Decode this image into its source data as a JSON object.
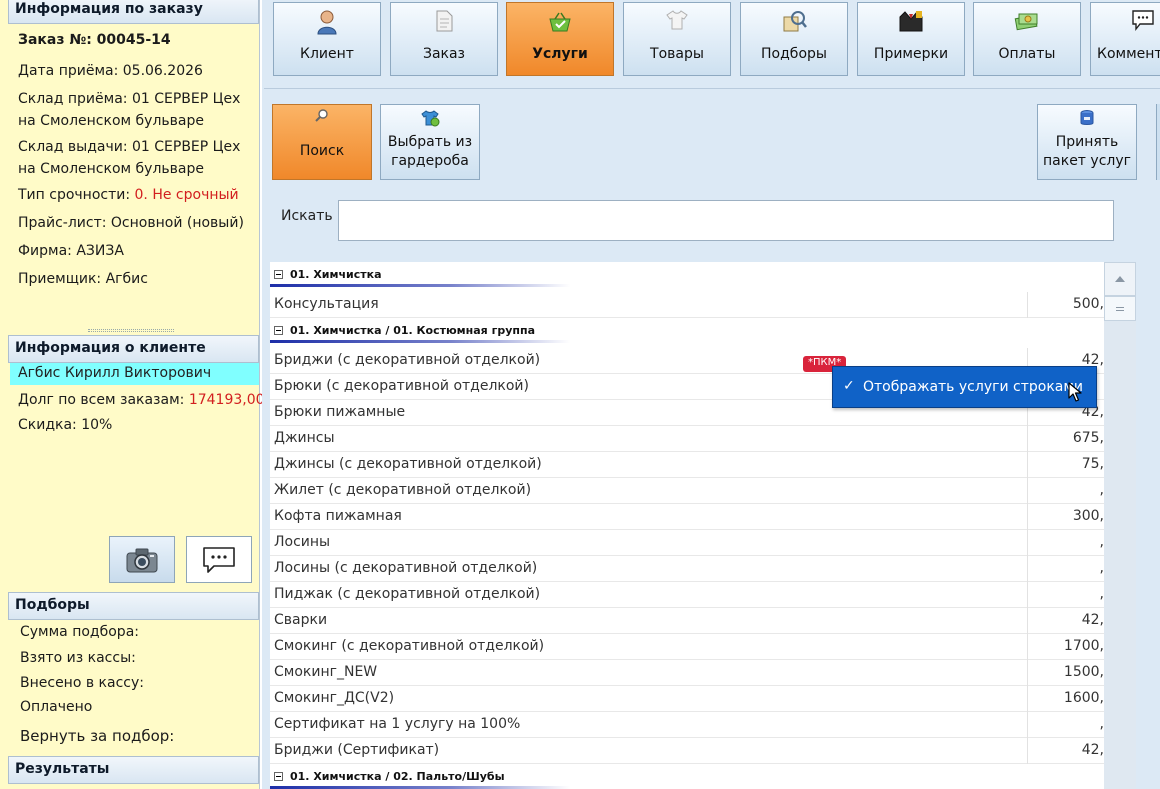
{
  "left_panel": {
    "order_info": {
      "header": "Информация по заказу",
      "order_number": "Заказ №: 00045-14",
      "received_date": "Дата приёма: 05.06.2026",
      "receive_warehouse": "Склад приёма: 01 СЕРВЕР Цех на Смоленском бульваре",
      "issue_warehouse": "Склад выдачи: 01 СЕРВЕР Цех на Смоленском бульваре",
      "urgency_label": "Тип срочности: ",
      "urgency_value": "0. Не срочный",
      "price_list": "Прайс-лист: Основной (новый)",
      "firm": "Фирма: АЗИЗА",
      "receiver": "Приемщик: Агбис"
    },
    "client_info": {
      "header": "Информация о клиенте",
      "name": "Агбис Кирилл Викторович",
      "debt_label": "Долг по всем заказам: ",
      "debt_value": "174193,00",
      "discount": "Скидка: 10%"
    },
    "selections": {
      "header": "Подборы",
      "sum": "Сумма подбора:",
      "taken": "Взято из кассы:",
      "deposited": "Внесено в кассу:",
      "paid": "Оплачено",
      "return": "Вернуть за подбор:"
    },
    "results": {
      "header": "Результаты"
    }
  },
  "tabs": [
    {
      "label": "Клиент",
      "icon": "person-icon"
    },
    {
      "label": "Заказ",
      "icon": "document-icon"
    },
    {
      "label": "Услуги",
      "icon": "basket-check-icon",
      "active": true
    },
    {
      "label": "Товары",
      "icon": "shirt-icon"
    },
    {
      "label": "Подборы",
      "icon": "selection-icon"
    },
    {
      "label": "Примерки",
      "icon": "suit-icon"
    },
    {
      "label": "Оплаты",
      "icon": "money-icon"
    },
    {
      "label": "Коммент",
      "icon": "comment-icon"
    }
  ],
  "toolbar": {
    "search": "Поиск",
    "wardrobe_line1": "Выбрать из",
    "wardrobe_line2": "гардероба",
    "package_line1": "Принять",
    "package_line2": "пакет услуг"
  },
  "search": {
    "label": "Искать",
    "value": ""
  },
  "grid": {
    "groups": [
      {
        "title": "01. Химчистка",
        "rows": [
          {
            "name": "Консультация",
            "price": "500,"
          }
        ]
      },
      {
        "title": "01. Химчистка / 01. Костюмная группа",
        "rows": [
          {
            "name": "Бриджи (с декоративной отделкой)",
            "price": "42,"
          },
          {
            "name": "Брюки (с декоративной отделкой)",
            "price": ""
          },
          {
            "name": "Брюки пижамные",
            "price": "42,"
          },
          {
            "name": "Джинсы",
            "price": "675,"
          },
          {
            "name": "Джинсы (с декоративной отделкой)",
            "price": "75,"
          },
          {
            "name": "Жилет (с декоративной отделкой)",
            "price": ","
          },
          {
            "name": "Кофта пижамная",
            "price": "300,"
          },
          {
            "name": "Лосины",
            "price": ","
          },
          {
            "name": "Лосины (с декоративной отделкой)",
            "price": ","
          },
          {
            "name": "Пиджак (с декоративной отделкой)",
            "price": ","
          },
          {
            "name": "Сварки",
            "price": "42,"
          },
          {
            "name": "Смокинг (с декоративной отделкой)",
            "price": "1700,"
          },
          {
            "name": "Смокинг_NEW",
            "price": "1500,"
          },
          {
            "name": "Смокинг_ДС(V2)",
            "price": "1600,"
          },
          {
            "name": "Сертификат на 1 услугу на 100%",
            "price": ","
          },
          {
            "name": "Бриджи (Сертификат)",
            "price": "42,"
          }
        ]
      },
      {
        "title": "01. Химчистка / 02. Пальто/Шубы",
        "rows": []
      }
    ]
  },
  "context_menu": {
    "badge": "*ПКМ*",
    "check": "✓",
    "item": "Отображать услуги строками"
  },
  "colors": {
    "accent_orange": "#f0882a",
    "panel_yellow": "#fffbc8",
    "highlight_cyan": "#80ffff",
    "menu_blue": "#1062c7",
    "alert_red": "#d21f1f"
  }
}
